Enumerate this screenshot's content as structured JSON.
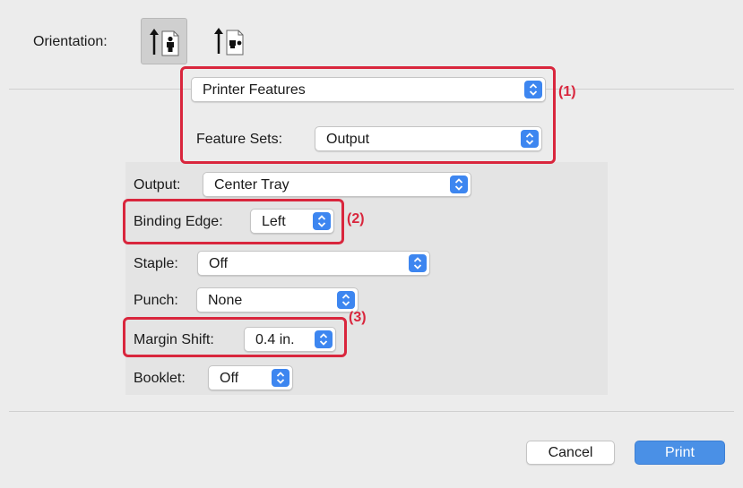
{
  "orientation": {
    "label": "Orientation:",
    "options": [
      {
        "name": "Portrait",
        "selected": true,
        "icon": "portrait-orientation-icon"
      },
      {
        "name": "Landscape",
        "selected": false,
        "icon": "landscape-orientation-icon"
      }
    ]
  },
  "panel_select": {
    "value": "Printer Features"
  },
  "feature_sets": {
    "label": "Feature Sets:",
    "value": "Output"
  },
  "options": {
    "output": {
      "label": "Output:",
      "value": "Center Tray"
    },
    "binding_edge": {
      "label": "Binding Edge:",
      "value": "Left"
    },
    "staple": {
      "label": "Staple:",
      "value": "Off"
    },
    "punch": {
      "label": "Punch:",
      "value": "None"
    },
    "margin_shift": {
      "label": "Margin Shift:",
      "value": "0.4 in."
    },
    "booklet": {
      "label": "Booklet:",
      "value": "Off"
    }
  },
  "callouts": {
    "c1": "(1)",
    "c2": "(2)",
    "c3": "(3)"
  },
  "buttons": {
    "cancel": "Cancel",
    "print": "Print"
  },
  "colors": {
    "accent": "#3d86f0",
    "callout": "#d9263d",
    "print_button": "#4a90e6"
  }
}
